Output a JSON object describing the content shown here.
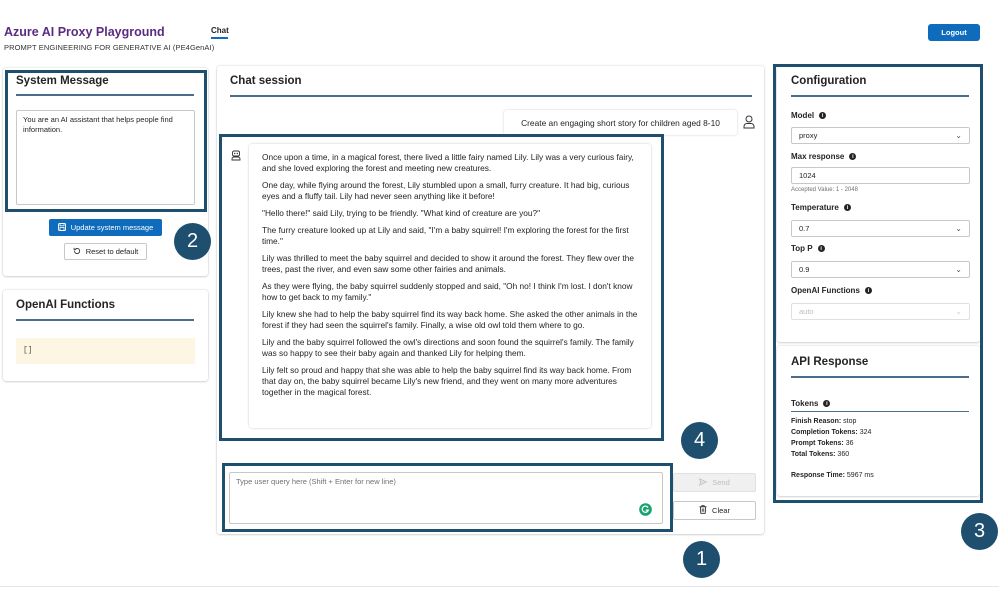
{
  "app": {
    "title": "Azure AI Proxy Playground",
    "subtitle": "PROMPT ENGINEERING FOR GENERATIVE AI (PE4GenAI)",
    "nav_tab": "Chat",
    "logout_label": "Logout"
  },
  "system_message": {
    "title": "System Message",
    "text": "You are an AI assistant that helps people find information.",
    "update_label": "Update system message",
    "reset_label": "Reset to default"
  },
  "functions": {
    "title": "OpenAI Functions",
    "value": "[]"
  },
  "chat": {
    "title": "Chat session",
    "user_message": "Create an engaging short story for children aged 8-10",
    "assistant_paragraphs": [
      "Once upon a time, in a magical forest, there lived a little fairy named Lily. Lily was a very curious fairy, and she loved exploring the forest and meeting new creatures.",
      "One day, while flying around the forest, Lily stumbled upon a small, furry creature. It had big, curious eyes and a fluffy tail. Lily had never seen anything like it before!",
      "\"Hello there!\" said Lily, trying to be friendly. \"What kind of creature are you?\"",
      "The furry creature looked up at Lily and said, \"I'm a baby squirrel! I'm exploring the forest for the first time.\"",
      "Lily was thrilled to meet the baby squirrel and decided to show it around the forest. They flew over the trees, past the river, and even saw some other fairies and animals.",
      "As they were flying, the baby squirrel suddenly stopped and said, \"Oh no! I think I'm lost. I don't know how to get back to my family.\"",
      "Lily knew she had to help the baby squirrel find its way back home. She asked the other animals in the forest if they had seen the squirrel's family. Finally, a wise old owl told them where to go.",
      "Lily and the baby squirrel followed the owl's directions and soon found the squirrel's family. The family was so happy to see their baby again and thanked Lily for helping them.",
      "Lily felt so proud and happy that she was able to help the baby squirrel find its way back home. From that day on, the baby squirrel became Lily's new friend, and they went on many more adventures together in the magical forest."
    ],
    "input_placeholder": "Type user query here (Shift + Enter for new line)",
    "send_label": "Send",
    "clear_label": "Clear"
  },
  "config": {
    "title": "Configuration",
    "model_label": "Model",
    "model_value": "proxy",
    "max_response_label": "Max response",
    "max_response_value": "1024",
    "max_response_hint": "Accepted Value: 1 - 2048",
    "temperature_label": "Temperature",
    "temperature_value": "0.7",
    "top_p_label": "Top P",
    "top_p_value": "0.9",
    "functions_label": "OpenAI Functions",
    "functions_value": "auto"
  },
  "api_response": {
    "title": "API Response",
    "tokens_label": "Tokens",
    "finish_reason_label": "Finish Reason:",
    "finish_reason_value": "stop",
    "completion_label": "Completion Tokens:",
    "completion_value": "324",
    "prompt_label": "Prompt Tokens:",
    "prompt_value": "36",
    "total_label": "Total Tokens:",
    "total_value": "360",
    "response_time_label": "Response Time:",
    "response_time_value": "5967 ms"
  },
  "callouts": [
    "1",
    "2",
    "3",
    "4"
  ],
  "colors": {
    "accent": "#0f6cbd",
    "brand": "#5b2b82",
    "callout": "#1e4f6e",
    "code_bg": "#fdf6e3"
  }
}
